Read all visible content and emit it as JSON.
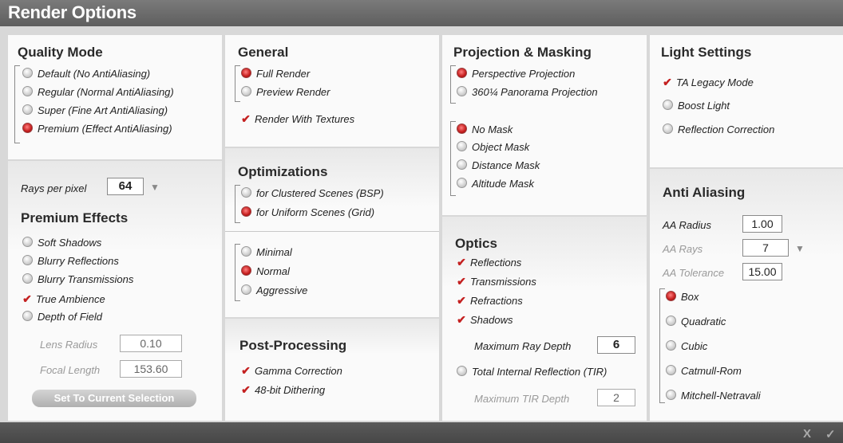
{
  "window": {
    "title": "Render Options"
  },
  "quality_mode": {
    "heading": "Quality Mode",
    "options": [
      {
        "label": "Default (No AntiAliasing)",
        "selected": false
      },
      {
        "label": "Regular (Normal AntiAliasing)",
        "selected": false
      },
      {
        "label": "Super (Fine Art AntiAliasing)",
        "selected": false
      },
      {
        "label": "Premium (Effect AntiAliasing)",
        "selected": true
      }
    ]
  },
  "rays": {
    "label": "Rays per pixel",
    "value": "64"
  },
  "premium_effects": {
    "heading": "Premium Effects",
    "options": [
      {
        "label": "Soft Shadows",
        "selected": false
      },
      {
        "label": "Blurry Reflections",
        "selected": false
      },
      {
        "label": "Blurry Transmissions",
        "selected": false
      },
      {
        "label": "True Ambience",
        "selected": true
      },
      {
        "label": "Depth of Field",
        "selected": false
      }
    ],
    "lens_radius": {
      "label": "Lens Radius",
      "value": "0.10"
    },
    "focal_length": {
      "label": "Focal Length",
      "value": "153.60"
    },
    "set_button": "Set To Current Selection"
  },
  "general": {
    "heading": "General",
    "options": [
      {
        "label": "Full Render",
        "selected": true
      },
      {
        "label": "Preview Render",
        "selected": false
      }
    ],
    "textures": {
      "label": "Render With Textures",
      "checked": true
    }
  },
  "optimizations": {
    "heading": "Optimizations",
    "scene": [
      {
        "label": "for Clustered Scenes (BSP)",
        "selected": false
      },
      {
        "label": "for Uniform Scenes (Grid)",
        "selected": true
      }
    ],
    "level": [
      {
        "label": "Minimal",
        "selected": false
      },
      {
        "label": "Normal",
        "selected": true
      },
      {
        "label": "Aggressive",
        "selected": false
      }
    ]
  },
  "post_processing": {
    "heading": "Post-Processing",
    "options": [
      {
        "label": "Gamma Correction",
        "checked": true
      },
      {
        "label": "48-bit Dithering",
        "checked": true
      }
    ]
  },
  "projection": {
    "heading": "Projection & Masking",
    "projections": [
      {
        "label": "Perspective Projection",
        "selected": true
      },
      {
        "label": "360¼ Panorama Projection",
        "selected": false
      }
    ],
    "masks": [
      {
        "label": "No Mask",
        "selected": true
      },
      {
        "label": "Object Mask",
        "selected": false
      },
      {
        "label": "Distance Mask",
        "selected": false
      },
      {
        "label": "Altitude Mask",
        "selected": false
      }
    ]
  },
  "optics": {
    "heading": "Optics",
    "options": [
      {
        "label": "Reflections",
        "checked": true
      },
      {
        "label": "Transmissions",
        "checked": true
      },
      {
        "label": "Refractions",
        "checked": true
      },
      {
        "label": "Shadows",
        "checked": true
      }
    ],
    "max_ray_depth": {
      "label": "Maximum Ray Depth",
      "value": "6"
    },
    "tir": {
      "label": "Total Internal Reflection (TIR)",
      "selected": false
    },
    "max_tir_depth": {
      "label": "Maximum TIR Depth",
      "value": "2"
    }
  },
  "light": {
    "heading": "Light Settings",
    "legacy": {
      "label": "TA Legacy Mode",
      "checked": true
    },
    "options": [
      {
        "label": "Boost Light",
        "selected": false
      },
      {
        "label": "Reflection Correction",
        "selected": false
      }
    ]
  },
  "anti_aliasing": {
    "heading": "Anti Aliasing",
    "aa_radius": {
      "label": "AA Radius",
      "value": "1.00"
    },
    "aa_rays": {
      "label": "AA Rays",
      "value": "7"
    },
    "aa_tolerance": {
      "label": "AA Tolerance",
      "value": "15.00"
    },
    "filters": [
      {
        "label": "Box",
        "selected": true
      },
      {
        "label": "Quadratic",
        "selected": false
      },
      {
        "label": "Cubic",
        "selected": false
      },
      {
        "label": "Catmull-Rom",
        "selected": false
      },
      {
        "label": "Mitchell-Netravali",
        "selected": false
      }
    ]
  },
  "footer": {
    "cancel": "X",
    "ok": "✓"
  },
  "icons": {
    "dropdown": "triangle-down",
    "check": "✔"
  },
  "colors": {
    "accent": "#c41c1c",
    "titlebar": "#6a6a6a"
  }
}
